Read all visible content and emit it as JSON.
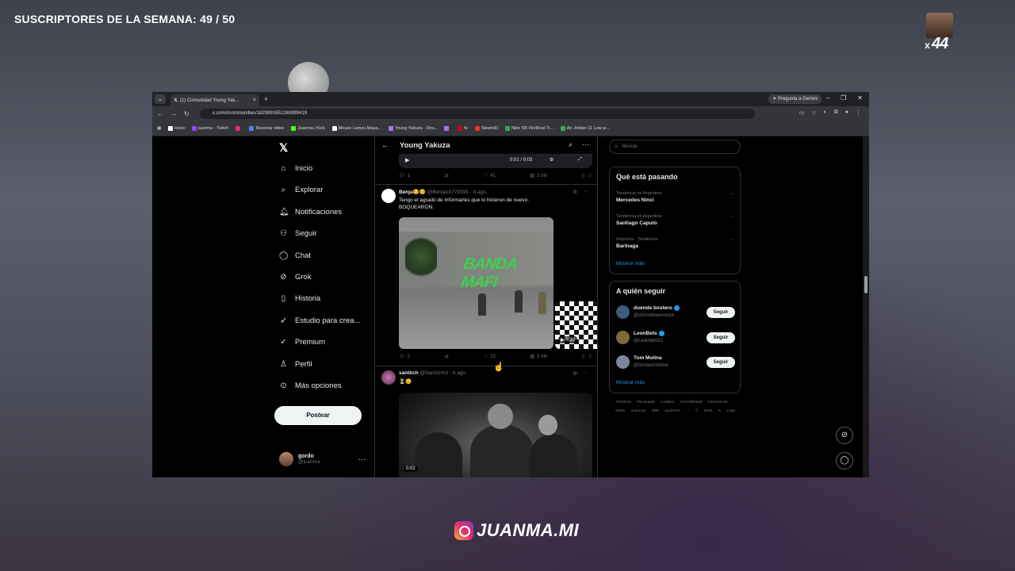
{
  "overlay": {
    "subs_label": "SUSCRIPTORES DE LA SEMANA: 49 / 50",
    "cam_x": "x",
    "cam_count": "44",
    "brand": "JUANMA.MI"
  },
  "browser": {
    "tab_title": "(1) Comunidad Young Yak...",
    "tab_close": "×",
    "new_tab": "+",
    "gemini": "Pregunta a Gemini",
    "url": "x.com/i/communities/1829991651260899419",
    "bookmarks": [
      {
        "label": "Inicio",
        "color": "#ffffff"
      },
      {
        "label": "juanma - Twitch",
        "color": "#9146ff"
      },
      {
        "label": "",
        "color": "#e1306c"
      },
      {
        "label": "Recortar video",
        "color": "#4285f4"
      },
      {
        "label": "Juanma | Kick",
        "color": "#53fc18"
      },
      {
        "label": "Mouse Lamzu Maya...",
        "color": "#ffffff"
      },
      {
        "label": "Young Yakuza - Dov...",
        "color": "#a970ff"
      },
      {
        "label": "",
        "color": "#a970ff"
      },
      {
        "label": "fv",
        "color": "#d0021b"
      },
      {
        "label": "SteamID",
        "color": "#e8361b"
      },
      {
        "label": "Nike SB Flo/Real Tr...",
        "color": "#34a853"
      },
      {
        "label": "Air Jordan 11 Low w...",
        "color": "#34a853"
      }
    ]
  },
  "nav": {
    "items": [
      {
        "label": "Inicio",
        "icon": "home-icon"
      },
      {
        "label": "Explorar",
        "icon": "search-icon"
      },
      {
        "label": "Notificaciones",
        "icon": "bell-icon"
      },
      {
        "label": "Seguir",
        "icon": "add-user-icon"
      },
      {
        "label": "Chat",
        "icon": "chat-icon"
      },
      {
        "label": "Grok",
        "icon": "grok-icon"
      },
      {
        "label": "Historia",
        "icon": "bookmark-icon"
      },
      {
        "label": "Estudio para crea...",
        "icon": "rocket-icon"
      },
      {
        "label": "Premium",
        "icon": "check-circle-icon"
      },
      {
        "label": "Perfil",
        "icon": "person-icon"
      },
      {
        "label": "Más opciones",
        "icon": "more-icon"
      }
    ],
    "post_button": "Postear",
    "user_name": "gordo",
    "user_handle": "@juanma"
  },
  "feed": {
    "header_title": "Young Yakuza",
    "top_video_time": "0:01 / 0:03",
    "top_actions": {
      "replies": "1",
      "likes": "41",
      "views": "2 mil"
    },
    "tweet1": {
      "name": "Benja😏😊",
      "handle_date": "@Benja18779395 · 8 ago.",
      "text_line1": "Tengo el agradó de informarles que lo hicieron de nuevo.",
      "text_line2": "BOQUEARON.",
      "graffiti": "BANDA MAFI",
      "video_duration": "0:30",
      "replies": "2",
      "likes": "23",
      "views": "2 mil"
    },
    "tweet2": {
      "name": "santiich",
      "handle_date": "@Santichh3 · 4 ago.",
      "text": "⏳😊",
      "video_duration": "0:02"
    }
  },
  "sidebar": {
    "search_placeholder": "Buscar",
    "trends_title": "Qué está pasando",
    "trends": [
      {
        "category": "Tendencia en Argentina",
        "name": "Mercedes Ninci"
      },
      {
        "category": "Tendencia en Argentina",
        "name": "Santiago Caputo"
      },
      {
        "category": "Deportes · Tendencia",
        "name": "Barinaga"
      }
    ],
    "trends_more": "Mostrar más",
    "follow_title": "A quién seguir",
    "follow": [
      {
        "name": "duende bostero",
        "handle": "@chombitaxeneize",
        "button": "Seguir",
        "color": "#3b5b78"
      },
      {
        "name": "LeonBets",
        "handle": "@Leonbets22",
        "button": "Seguir",
        "color": "#7b6a3a"
      },
      {
        "name": "Tom Molina",
        "handle": "@tomasemolina",
        "button": "Seguir",
        "color": "#7a8899"
      }
    ],
    "follow_more": "Mostrar más",
    "footer_links": "Términos  Privacidad  Cookies  Accesibilidad  Información sobre anuncios  Más opciones ···  © 2025 X Corp."
  }
}
